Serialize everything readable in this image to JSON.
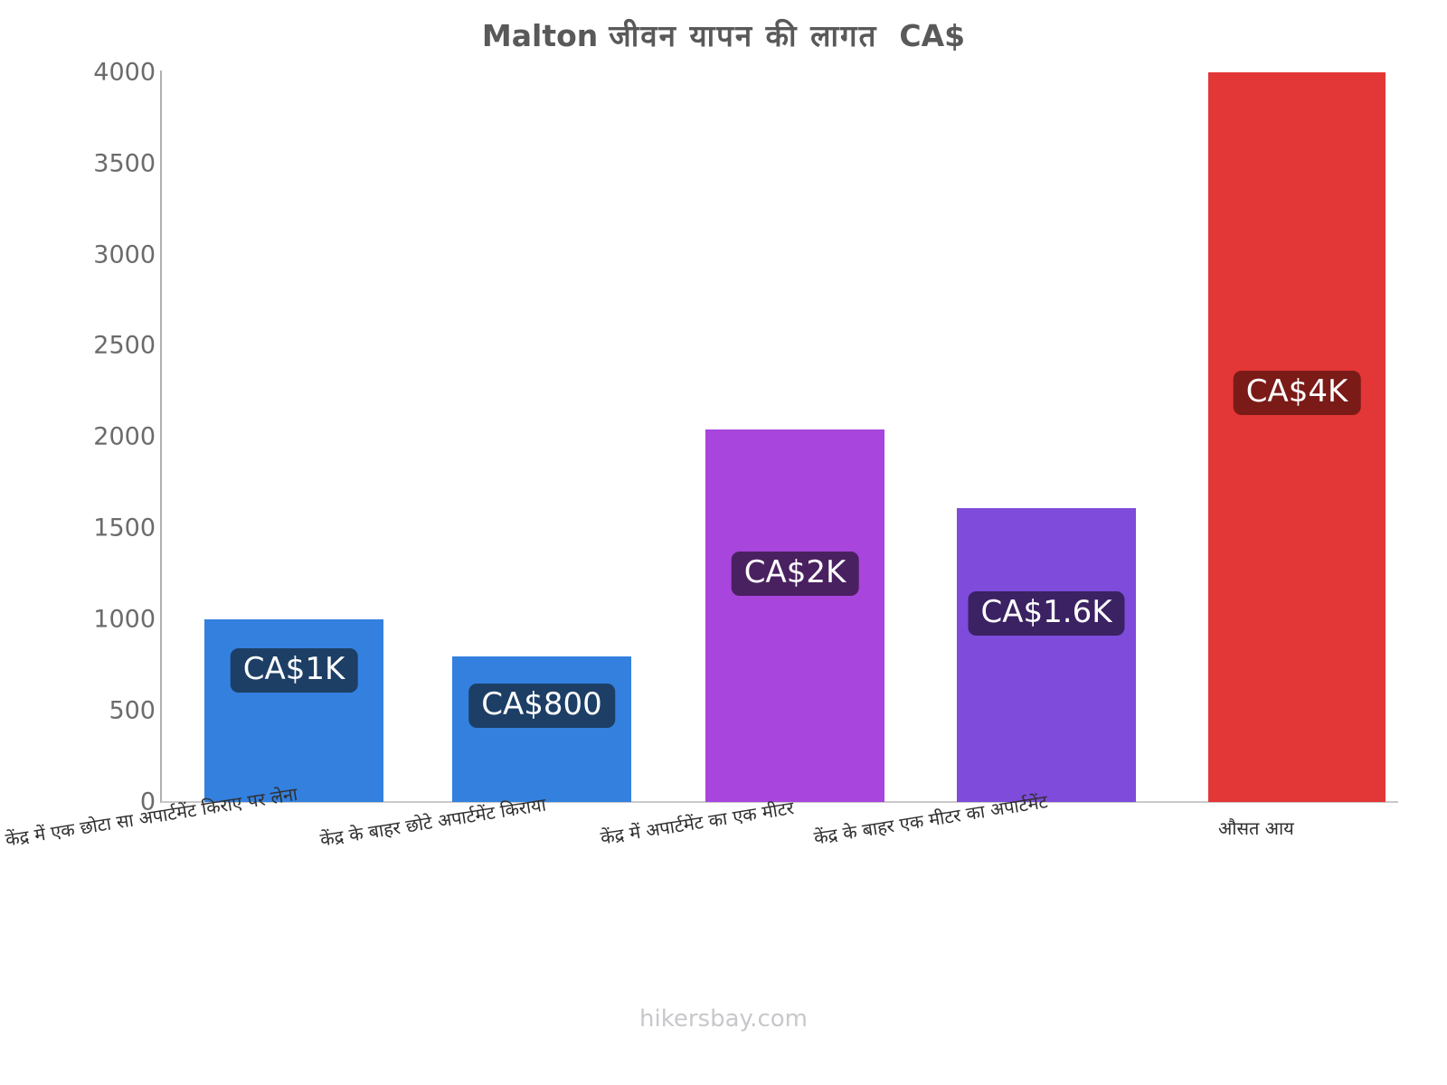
{
  "title": {
    "latin_prefix": "Malton",
    "devanagari": "जीवन  यापन  की  लागत",
    "currency": "CA$",
    "full": "Malton जीवन  यापन  की  लागत  CA$"
  },
  "footer": {
    "credit": "hikersbay.com"
  },
  "colors": {
    "bar_blue": "#3380DF",
    "bar_magenta": "#A845DC",
    "bar_violet": "#7E4BDB",
    "bar_red": "#E33636",
    "badge_blue": "#1D3F66",
    "badge_magenta": "#4A2160",
    "badge_violet": "#3A2263",
    "badge_red": "#7A1B18",
    "title_text": "#595959",
    "tick_text": "#6b6b6b",
    "axis_line": "#b5b5b5",
    "footer_text": "#c8c8cc"
  },
  "chart_data": {
    "type": "bar",
    "title": "Malton जीवन  यापन  की  लागत  CA$",
    "xlabel": "",
    "ylabel": "",
    "ylim": [
      0,
      4000
    ],
    "yticks": [
      0,
      500,
      1000,
      1500,
      2000,
      2500,
      3000,
      3500,
      4000
    ],
    "ytick_labels": [
      "0",
      "500",
      "1000",
      "1500",
      "2000",
      "2500",
      "3000",
      "3500",
      "4000"
    ],
    "grid": false,
    "legend": "none",
    "currency": "CA$",
    "categories": [
      "केंद्र में एक छोटा सा अपार्टमेंट किराए पर लेना",
      "केंद्र के बाहर छोटे अपार्टमेंट किराया",
      "केंद्र में अपार्टमेंट का एक मीटर",
      "केंद्र के बाहर एक मीटर का अपार्टमेंट",
      "औसत आय"
    ],
    "values": [
      1000,
      800,
      2040,
      1610,
      4000
    ],
    "data_labels": [
      "CA$1K",
      "CA$800",
      "CA$2K",
      "CA$1.6K",
      "CA$4K"
    ],
    "bar_colors": [
      "#3380DF",
      "#3380DF",
      "#A845DC",
      "#7E4BDB",
      "#E33636"
    ],
    "badge_colors": [
      "#1D3F66",
      "#1D3F66",
      "#4A2160",
      "#3A2263",
      "#7A1B18"
    ]
  },
  "bars": [
    {
      "label": "केंद्र में एक छोटा सा अपार्टमेंट किराए पर लेना",
      "value": 1000,
      "value_label": "CA$1K",
      "color": "#3380DF",
      "badge_color": "#1D3F66"
    },
    {
      "label": "केंद्र के बाहर छोटे अपार्टमेंट किराया",
      "value": 800,
      "value_label": "CA$800",
      "color": "#3380DF",
      "badge_color": "#1D3F66"
    },
    {
      "label": "केंद्र में अपार्टमेंट का एक मीटर",
      "value": 2040,
      "value_label": "CA$2K",
      "color": "#A845DC",
      "badge_color": "#4A2160"
    },
    {
      "label": "केंद्र के बाहर एक मीटर का अपार्टमेंट",
      "value": 1610,
      "value_label": "CA$1.6K",
      "color": "#7E4BDB",
      "badge_color": "#3A2263"
    },
    {
      "label": "औसत आय",
      "value": 4000,
      "value_label": "CA$4K",
      "color": "#E33636",
      "badge_color": "#7A1B18"
    }
  ]
}
